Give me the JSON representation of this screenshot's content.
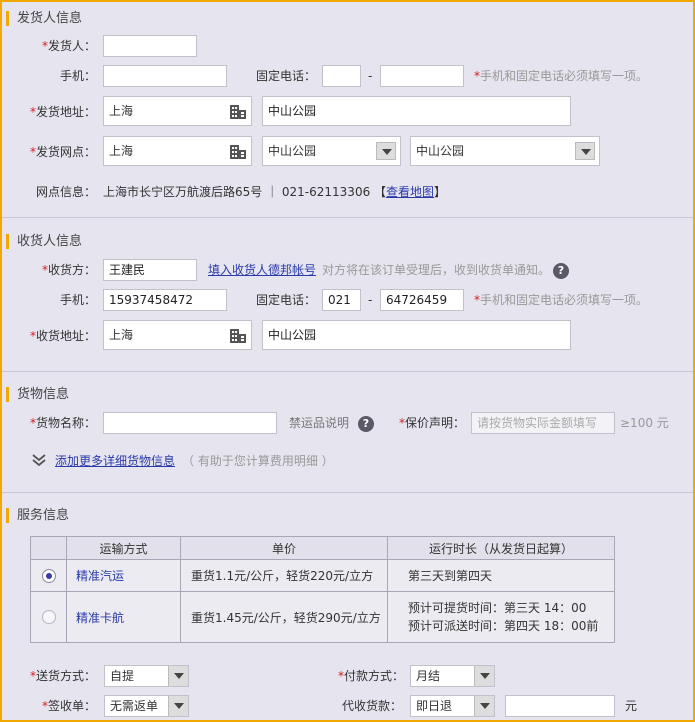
{
  "sender": {
    "title": "发货人信息",
    "name_label": "发货人：",
    "name_value": "",
    "mobile_label": "手机：",
    "mobile_value": "",
    "phone_label": "固定电话：",
    "area_value": "",
    "dash": "-",
    "phone_value": "",
    "phone_hint": "手机和固定电话必须填写一项。",
    "address_label": "发货地址：",
    "address_city": "上海",
    "address_detail": "中山公园",
    "network_label": "发货网点：",
    "network_city": "上海",
    "network_sel1": "中山公园",
    "network_sel2": "中山公园",
    "info_label": "网点信息：",
    "info_text": "上海市长宁区万航渡后路65号 ｜ 021-62113306 【",
    "map_link": "查看地图",
    "info_close": "】"
  },
  "receiver": {
    "title": "收货人信息",
    "name_label": "收货方：",
    "name_value": "王建民",
    "account_link": "填入收货人德邦帐号",
    "account_hint": "对方将在该订单受理后，收到收货单通知。",
    "mobile_label": "手机：",
    "mobile_value": "15937458472",
    "phone_label": "固定电话：",
    "area_value": "021",
    "dash": "-",
    "phone_value": "64726459",
    "phone_hint": "手机和固定电话必须填写一项。",
    "address_label": "收货地址：",
    "address_city": "上海",
    "address_detail": "中山公园"
  },
  "goods": {
    "title": "货物信息",
    "name_label": "货物名称：",
    "name_value": "",
    "forbidden_label": "禁运品说明",
    "insure_label": "保价声明：",
    "insure_placeholder": "请按货物实际金额填写",
    "insure_min": "≥100 元",
    "more_link": "添加更多详细货物信息",
    "more_hint": "（ 有助于您计算费用明细 ）"
  },
  "service": {
    "title": "服务信息",
    "headers": [
      "运输方式",
      "单价",
      "运行时长（从发货日起算）"
    ],
    "rows": [
      {
        "name": "精准汽运",
        "price": "重货1.1元/公斤，轻货220元/立方",
        "time1": "第三天到第四天",
        "time2": ""
      },
      {
        "name": "精准卡航",
        "price": "重货1.45元/公斤，轻货290元/立方",
        "time1": "预计可提货时间：第三天 14：00",
        "time2": "预计可派送时间：第四天 18：00前"
      }
    ],
    "delivery_label": "送货方式：",
    "delivery_value": "自提",
    "payment_label": "付款方式：",
    "payment_value": "月结",
    "sign_label": "签收单：",
    "sign_value": "无需返单",
    "cod_label": "代收货款：",
    "cod_value": "即日退",
    "cod_amount": "",
    "cod_unit": "元"
  },
  "required_mark": "*",
  "colors": {
    "accent": "#f1a800",
    "required": "#d42020",
    "link": "#2a3aa8",
    "panel": "#e6e4ef"
  }
}
